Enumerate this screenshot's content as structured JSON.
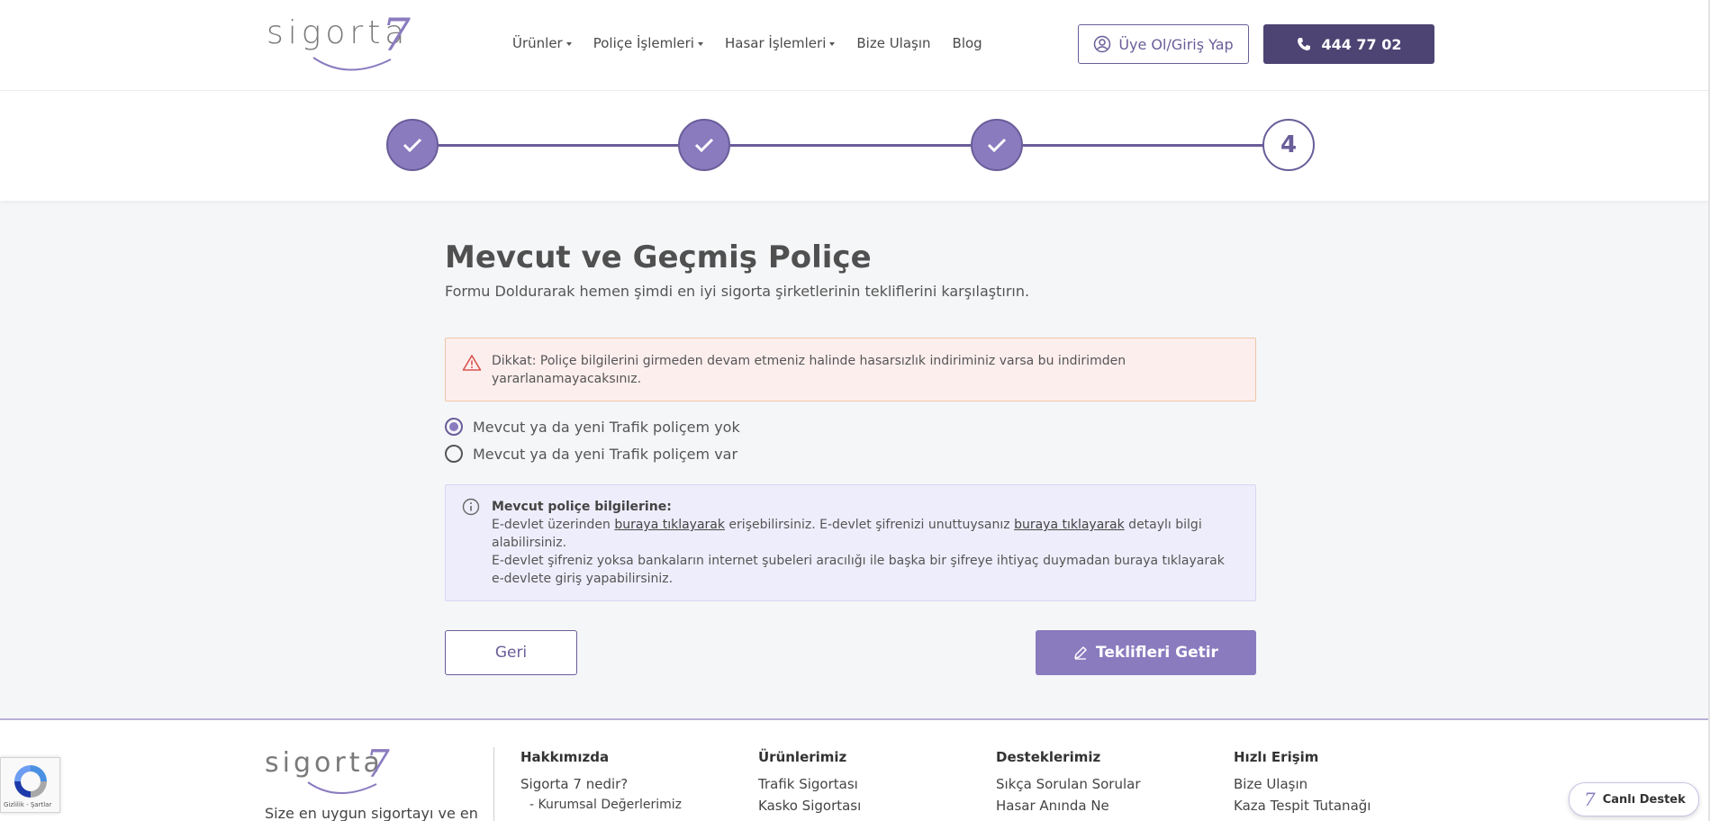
{
  "header": {
    "logo_text": "sigorta",
    "logo_digit": "7",
    "nav": [
      {
        "label": "Ürünler",
        "dropdown": true
      },
      {
        "label": "Poliçe İşlemleri",
        "dropdown": true
      },
      {
        "label": "Hasar İşlemleri",
        "dropdown": true
      },
      {
        "label": "Bize Ulaşın",
        "dropdown": false
      },
      {
        "label": "Blog",
        "dropdown": false
      }
    ],
    "login_label": "Üye Ol/Giriş Yap",
    "phone_label": "444 77 02"
  },
  "stepper": {
    "steps": [
      {
        "state": "done",
        "icon": "check-icon"
      },
      {
        "state": "done",
        "icon": "check-icon"
      },
      {
        "state": "done",
        "icon": "check-icon"
      },
      {
        "state": "current",
        "label": "4"
      }
    ]
  },
  "main": {
    "title": "Mevcut ve Geçmiş Poliçe",
    "subtitle": "Formu Doldurarak hemen şimdi en iyi sigorta şirketlerinin tekliflerini karşılaştırın.",
    "alert_text": "Dikkat: Poliçe bilgilerini girmeden devam etmeniz halinde hasarsızlık indiriminiz varsa bu indirimden yararlanamayacaksınız.",
    "radio_options": [
      {
        "label": "Mevcut ya da yeni Trafik poliçem yok",
        "checked": true
      },
      {
        "label": "Mevcut ya da yeni Trafik poliçem var",
        "checked": false
      }
    ],
    "info": {
      "heading": "Mevcut poliçe bilgilerine:",
      "line1_a": "E-devlet üzerinden ",
      "link1": "buraya tıklayarak",
      "line1_b": " erişebilirsiniz. E-devlet şifrenizi unuttuysanız ",
      "link2": "buraya tıklayarak",
      "line1_c": " detaylı bilgi alabilirsiniz.",
      "line2": "E-devlet şifreniz yoksa bankaların internet şubeleri aracılığı ile başka bir şifreye ihtiyaç duymadan buraya tıklayarak e-devlete giriş yapabilirsiniz."
    },
    "back_label": "Geri",
    "offers_label": "Teklifleri Getir"
  },
  "footer": {
    "tagline": "Size en uygun sigortayı ve en",
    "columns": [
      {
        "heading": "Hakkımızda",
        "links": [
          "Sigorta 7 nedir?",
          "- Kurumsal Değerlerimiz"
        ]
      },
      {
        "heading": "Ürünlerimiz",
        "links": [
          "Trafik Sigortası",
          "Kasko Sigortası"
        ]
      },
      {
        "heading": "Desteklerimiz",
        "links": [
          "Sıkça Sorulan Sorular",
          "Hasar Anında Ne"
        ]
      },
      {
        "heading": "Hızlı Erişim",
        "links": [
          "Bize Ulaşın",
          "Kaza Tespit Tutanağı"
        ]
      }
    ]
  },
  "recaptcha_text": "Gizlilik - Şartlar",
  "live_support_label": "Canlı Destek",
  "colors": {
    "primary": "#8a7bbf",
    "primary_dark": "#4d4473",
    "outline": "#6a5d99",
    "alert_bg": "#fdeeee",
    "info_bg": "#eeedfb"
  }
}
